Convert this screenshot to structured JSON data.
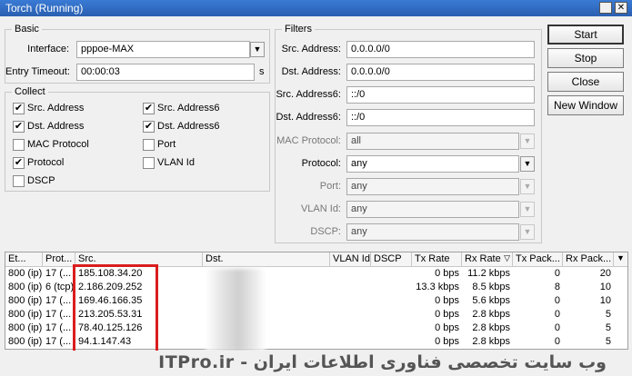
{
  "window": {
    "title": "Torch (Running)",
    "minimize_glyph": "▣",
    "close_glyph": "✕"
  },
  "basic": {
    "title": "Basic",
    "interface_label": "Interface:",
    "interface_value": "pppoe-MAX",
    "entry_timeout_label": "Entry Timeout:",
    "entry_timeout_value": "00:00:03",
    "entry_timeout_unit": "s"
  },
  "collect": {
    "title": "Collect",
    "items": [
      {
        "label": "Src. Address",
        "checked": true
      },
      {
        "label": "Dst. Address",
        "checked": true
      },
      {
        "label": "MAC Protocol",
        "checked": false
      },
      {
        "label": "Protocol",
        "checked": true
      },
      {
        "label": "DSCP",
        "checked": false
      },
      {
        "label": "Src. Address6",
        "checked": true
      },
      {
        "label": "Dst. Address6",
        "checked": true
      },
      {
        "label": "Port",
        "checked": false
      },
      {
        "label": "VLAN Id",
        "checked": false
      }
    ],
    "check_glyph": "✔"
  },
  "filters": {
    "title": "Filters",
    "src_address_label": "Src. Address:",
    "src_address_value": "0.0.0.0/0",
    "dst_address_label": "Dst. Address:",
    "dst_address_value": "0.0.0.0/0",
    "src_address6_label": "Src. Address6:",
    "src_address6_value": "::/0",
    "dst_address6_label": "Dst. Address6:",
    "dst_address6_value": "::/0",
    "mac_protocol_label": "MAC Protocol:",
    "mac_protocol_value": "all",
    "protocol_label": "Protocol:",
    "protocol_value": "any",
    "port_label": "Port:",
    "port_value": "any",
    "vlan_label": "VLAN Id:",
    "vlan_value": "any",
    "dscp_label": "DSCP:",
    "dscp_value": "any"
  },
  "buttons": {
    "start": "Start",
    "stop": "Stop",
    "close": "Close",
    "new_window": "New Window"
  },
  "table": {
    "headers": [
      "Et...",
      "Prot...",
      "Src.",
      "Dst.",
      "VLAN Id",
      "DSCP",
      "Tx Rate",
      "Rx Rate",
      "Tx Pack...",
      "Rx Pack..."
    ],
    "rows": [
      {
        "eth": "800 (ip)",
        "proto": "17 (...",
        "src": "185.108.34.20",
        "dst": "",
        "tx": "0 bps",
        "rx": "11.2 kbps",
        "txp": "0",
        "rxp": "20"
      },
      {
        "eth": "800 (ip)",
        "proto": "6 (tcp)",
        "src": "2.186.209.252",
        "dst": "",
        "tx": "13.3 kbps",
        "rx": "8.5 kbps",
        "txp": "8",
        "rxp": "10"
      },
      {
        "eth": "800 (ip)",
        "proto": "17 (...",
        "src": "169.46.166.35",
        "dst": "",
        "tx": "0 bps",
        "rx": "5.6 kbps",
        "txp": "0",
        "rxp": "10"
      },
      {
        "eth": "800 (ip)",
        "proto": "17 (...",
        "src": "213.205.53.31",
        "dst": "",
        "tx": "0 bps",
        "rx": "2.8 kbps",
        "txp": "0",
        "rxp": "5"
      },
      {
        "eth": "800 (ip)",
        "proto": "17 (...",
        "src": "78.40.125.126",
        "dst": "",
        "tx": "0 bps",
        "rx": "2.8 kbps",
        "txp": "0",
        "rxp": "5"
      },
      {
        "eth": "800 (ip)",
        "proto": "17 (...",
        "src": "94.1.147.43",
        "dst": "",
        "tx": "0 bps",
        "rx": "2.8 kbps",
        "txp": "0",
        "rxp": "5"
      }
    ]
  },
  "watermark": "وب سایت تخصصی فناوری اطلاعات ایران - ITPro.ir",
  "colors": {
    "highlight": "#d91d1d",
    "titlebar": "#2a5fb0"
  }
}
